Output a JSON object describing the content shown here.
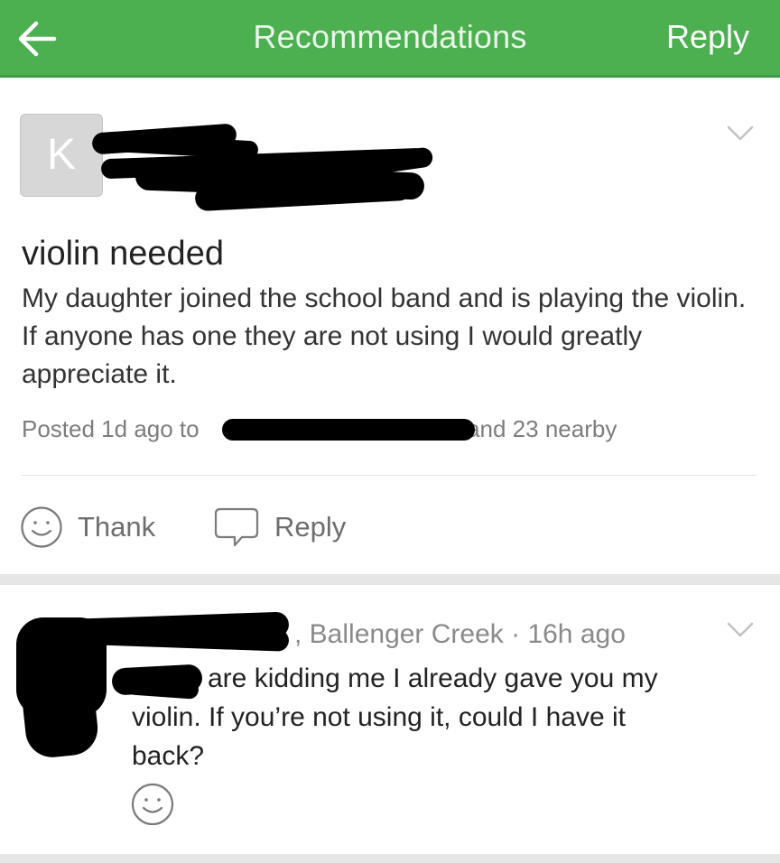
{
  "header": {
    "title": "Recommendations",
    "reply_label": "Reply",
    "back_icon": "arrow-left-icon",
    "background_color": "#4caf50"
  },
  "post": {
    "avatar_initial": "K",
    "title": "violin needed",
    "body": "My daughter joined the school band and is playing the violin. If anyone has one they are not using I would greatly appreciate it.",
    "meta_prefix": "Posted 1d ago to",
    "meta_suffix": "and 23 nearby",
    "actions": {
      "thank_label": "Thank",
      "thank_icon": "smiley-icon",
      "reply_label": "Reply",
      "reply_icon": "speech-bubble-icon"
    }
  },
  "comment": {
    "meta": ", Ballenger Creek · 16h ago",
    "text": "are kidding me I already gave you my violin. If you’re not using it, could I have it back?",
    "thank_icon": "smiley-icon"
  }
}
